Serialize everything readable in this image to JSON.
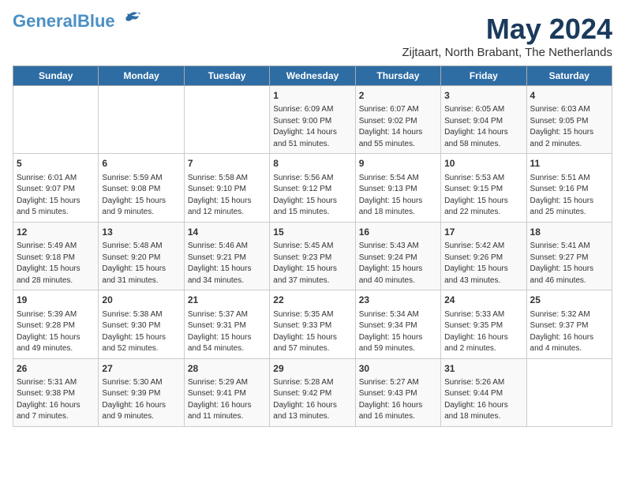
{
  "header": {
    "logo_general": "General",
    "logo_blue": "Blue",
    "month_year": "May 2024",
    "location": "Zijtaart, North Brabant, The Netherlands"
  },
  "weekdays": [
    "Sunday",
    "Monday",
    "Tuesday",
    "Wednesday",
    "Thursday",
    "Friday",
    "Saturday"
  ],
  "weeks": [
    [
      {
        "day": "",
        "info": ""
      },
      {
        "day": "",
        "info": ""
      },
      {
        "day": "",
        "info": ""
      },
      {
        "day": "1",
        "info": "Sunrise: 6:09 AM\nSunset: 9:00 PM\nDaylight: 14 hours\nand 51 minutes."
      },
      {
        "day": "2",
        "info": "Sunrise: 6:07 AM\nSunset: 9:02 PM\nDaylight: 14 hours\nand 55 minutes."
      },
      {
        "day": "3",
        "info": "Sunrise: 6:05 AM\nSunset: 9:04 PM\nDaylight: 14 hours\nand 58 minutes."
      },
      {
        "day": "4",
        "info": "Sunrise: 6:03 AM\nSunset: 9:05 PM\nDaylight: 15 hours\nand 2 minutes."
      }
    ],
    [
      {
        "day": "5",
        "info": "Sunrise: 6:01 AM\nSunset: 9:07 PM\nDaylight: 15 hours\nand 5 minutes."
      },
      {
        "day": "6",
        "info": "Sunrise: 5:59 AM\nSunset: 9:08 PM\nDaylight: 15 hours\nand 9 minutes."
      },
      {
        "day": "7",
        "info": "Sunrise: 5:58 AM\nSunset: 9:10 PM\nDaylight: 15 hours\nand 12 minutes."
      },
      {
        "day": "8",
        "info": "Sunrise: 5:56 AM\nSunset: 9:12 PM\nDaylight: 15 hours\nand 15 minutes."
      },
      {
        "day": "9",
        "info": "Sunrise: 5:54 AM\nSunset: 9:13 PM\nDaylight: 15 hours\nand 18 minutes."
      },
      {
        "day": "10",
        "info": "Sunrise: 5:53 AM\nSunset: 9:15 PM\nDaylight: 15 hours\nand 22 minutes."
      },
      {
        "day": "11",
        "info": "Sunrise: 5:51 AM\nSunset: 9:16 PM\nDaylight: 15 hours\nand 25 minutes."
      }
    ],
    [
      {
        "day": "12",
        "info": "Sunrise: 5:49 AM\nSunset: 9:18 PM\nDaylight: 15 hours\nand 28 minutes."
      },
      {
        "day": "13",
        "info": "Sunrise: 5:48 AM\nSunset: 9:20 PM\nDaylight: 15 hours\nand 31 minutes."
      },
      {
        "day": "14",
        "info": "Sunrise: 5:46 AM\nSunset: 9:21 PM\nDaylight: 15 hours\nand 34 minutes."
      },
      {
        "day": "15",
        "info": "Sunrise: 5:45 AM\nSunset: 9:23 PM\nDaylight: 15 hours\nand 37 minutes."
      },
      {
        "day": "16",
        "info": "Sunrise: 5:43 AM\nSunset: 9:24 PM\nDaylight: 15 hours\nand 40 minutes."
      },
      {
        "day": "17",
        "info": "Sunrise: 5:42 AM\nSunset: 9:26 PM\nDaylight: 15 hours\nand 43 minutes."
      },
      {
        "day": "18",
        "info": "Sunrise: 5:41 AM\nSunset: 9:27 PM\nDaylight: 15 hours\nand 46 minutes."
      }
    ],
    [
      {
        "day": "19",
        "info": "Sunrise: 5:39 AM\nSunset: 9:28 PM\nDaylight: 15 hours\nand 49 minutes."
      },
      {
        "day": "20",
        "info": "Sunrise: 5:38 AM\nSunset: 9:30 PM\nDaylight: 15 hours\nand 52 minutes."
      },
      {
        "day": "21",
        "info": "Sunrise: 5:37 AM\nSunset: 9:31 PM\nDaylight: 15 hours\nand 54 minutes."
      },
      {
        "day": "22",
        "info": "Sunrise: 5:35 AM\nSunset: 9:33 PM\nDaylight: 15 hours\nand 57 minutes."
      },
      {
        "day": "23",
        "info": "Sunrise: 5:34 AM\nSunset: 9:34 PM\nDaylight: 15 hours\nand 59 minutes."
      },
      {
        "day": "24",
        "info": "Sunrise: 5:33 AM\nSunset: 9:35 PM\nDaylight: 16 hours\nand 2 minutes."
      },
      {
        "day": "25",
        "info": "Sunrise: 5:32 AM\nSunset: 9:37 PM\nDaylight: 16 hours\nand 4 minutes."
      }
    ],
    [
      {
        "day": "26",
        "info": "Sunrise: 5:31 AM\nSunset: 9:38 PM\nDaylight: 16 hours\nand 7 minutes."
      },
      {
        "day": "27",
        "info": "Sunrise: 5:30 AM\nSunset: 9:39 PM\nDaylight: 16 hours\nand 9 minutes."
      },
      {
        "day": "28",
        "info": "Sunrise: 5:29 AM\nSunset: 9:41 PM\nDaylight: 16 hours\nand 11 minutes."
      },
      {
        "day": "29",
        "info": "Sunrise: 5:28 AM\nSunset: 9:42 PM\nDaylight: 16 hours\nand 13 minutes."
      },
      {
        "day": "30",
        "info": "Sunrise: 5:27 AM\nSunset: 9:43 PM\nDaylight: 16 hours\nand 16 minutes."
      },
      {
        "day": "31",
        "info": "Sunrise: 5:26 AM\nSunset: 9:44 PM\nDaylight: 16 hours\nand 18 minutes."
      },
      {
        "day": "",
        "info": ""
      }
    ]
  ]
}
